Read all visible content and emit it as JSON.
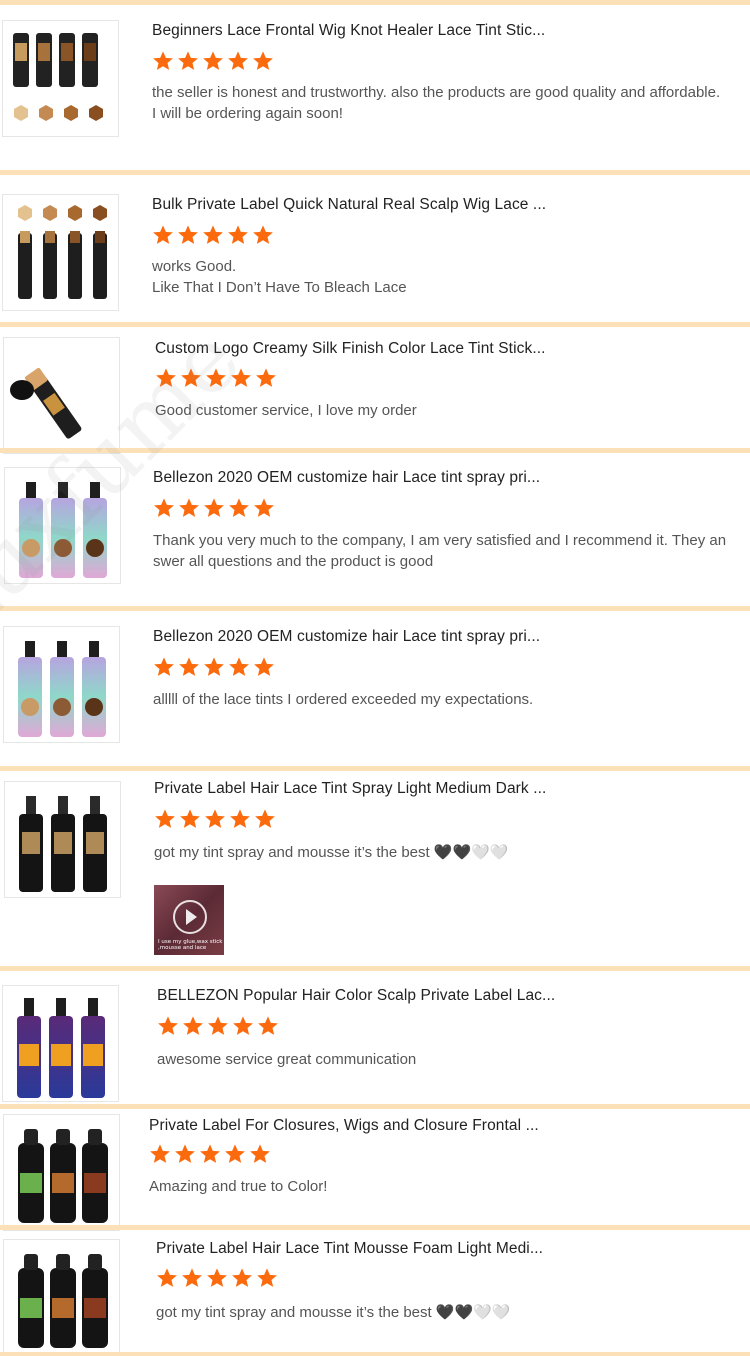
{
  "colors": {
    "star": "#fb6a0c",
    "separator": "#fbe0b8",
    "text": "#555555",
    "title": "#222222"
  },
  "watermark_text": "Luxfume",
  "reviews": [
    {
      "product_title": "Beginners Lace Frontal Wig Knot Healer Lace Tint Stic...",
      "rating": 5,
      "comment": "the seller is honest and trustworthy. also the products are good quality and affordable. I will be ordering again soon!",
      "thumbnail": "tint-stick-four-colors"
    },
    {
      "product_title": "Bulk Private Label Quick Natural Real Scalp Wig Lace ...",
      "rating": 5,
      "comment": "works Good.\nLike That I Don’t Have To Bleach Lace",
      "thumbnail": "tint-stick-swatches"
    },
    {
      "product_title": "Custom Logo Creamy Silk Finish Color Lace Tint Stick...",
      "rating": 5,
      "comment": "Good customer service,  I love my order",
      "thumbnail": "single-tint-stick"
    },
    {
      "product_title": "Bellezon 2020 OEM customize hair Lace tint spray pri...",
      "rating": 5,
      "comment": "Thank you very much to the company, I am very satisfied and I recommend it. They answer all questions and the product is good",
      "thumbnail": "lace-tint-spray-iridescent"
    },
    {
      "product_title": "Bellezon 2020 OEM customize hair Lace tint spray pri...",
      "rating": 5,
      "comment": "alllll of the lace tints I ordered exceeded my expectations.",
      "thumbnail": "lace-tint-spray-iridescent"
    },
    {
      "product_title": "Private Label Hair Lace Tint Spray Light Medium Dark ...",
      "rating": 5,
      "comment": "got my tint spray and mousse it’s the best 🖤🖤🤍🤍",
      "thumbnail": "lace-tint-spray-black",
      "video_caption": "I use my glue,wax stick ,mousse and lace"
    },
    {
      "product_title": "BELLEZON Popular Hair Color Scalp Private Label Lac...",
      "rating": 5,
      "comment": "awesome service great communication",
      "thumbnail": "lace-tint-spray-purple"
    },
    {
      "product_title": "Private Label For Closures, Wigs and Closure Frontal ...",
      "rating": 5,
      "comment": "Amazing and true to Color!",
      "thumbnail": "tint-mousse-three"
    },
    {
      "product_title": "Private Label Hair Lace Tint Mousse Foam Light Medi...",
      "rating": 5,
      "comment": "got my tint spray and mousse it’s the best 🖤🖤🤍🤍",
      "thumbnail": "tint-mousse-three"
    }
  ]
}
